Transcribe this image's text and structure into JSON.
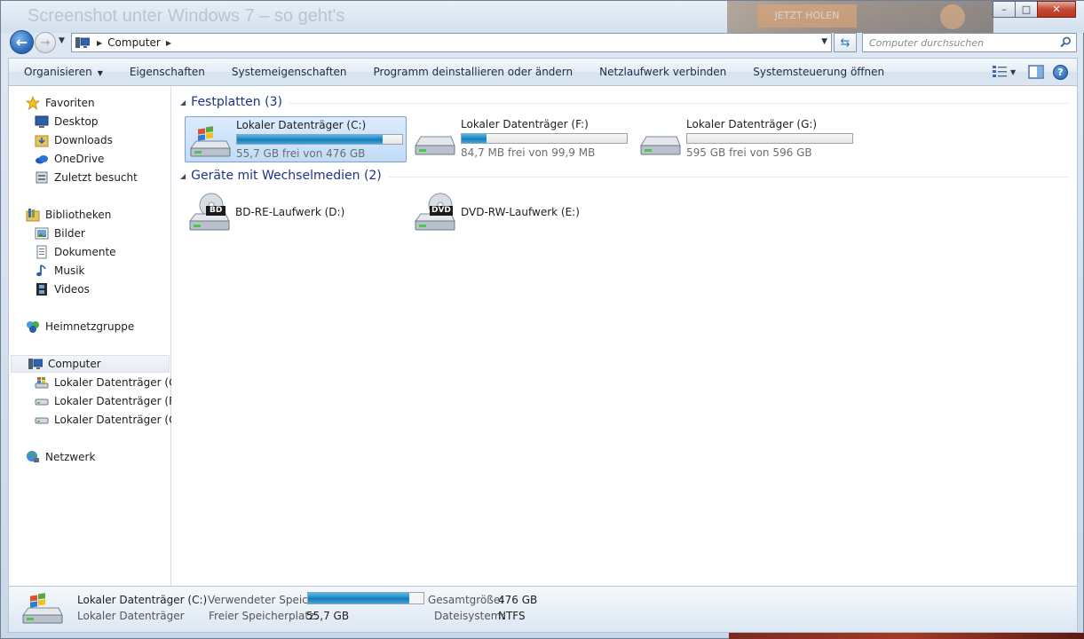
{
  "window": {
    "ghost_title": "Screenshot unter Windows 7 – so geht's",
    "ad_button": "JETZT HOLEN",
    "caption_min": "–",
    "caption_max": "□",
    "caption_close": "✕"
  },
  "address": {
    "crumb": "Computer",
    "search_placeholder": "Computer durchsuchen"
  },
  "toolbar": {
    "organize": "Organisieren",
    "items": [
      "Eigenschaften",
      "Systemeigenschaften",
      "Programm deinstallieren oder ändern",
      "Netzlaufwerk verbinden",
      "Systemsteuerung öffnen"
    ],
    "help": "?"
  },
  "nav": {
    "favorites": "Favoriten",
    "desktop": "Desktop",
    "downloads": "Downloads",
    "onedrive": "OneDrive",
    "recent": "Zuletzt besucht",
    "libraries": "Bibliotheken",
    "pictures": "Bilder",
    "documents": "Dokumente",
    "music": "Musik",
    "videos": "Videos",
    "homegroup": "Heimnetzgruppe",
    "computer": "Computer",
    "drive_c": "Lokaler Datenträger (C:)",
    "drive_f": "Lokaler Datenträger (F:)",
    "drive_g": "Lokaler Datenträger (G:)",
    "network": "Netzwerk"
  },
  "groups": {
    "hard_disks": "Festplatten (3)",
    "removable": "Geräte mit Wechselmedien (2)"
  },
  "drives": [
    {
      "name": "Lokaler Datenträger (C:)",
      "free": "55,7 GB frei von 476 GB",
      "used_fraction": 0.88
    },
    {
      "name": "Lokaler Datenträger (F:)",
      "free": "84,7 MB frei von 99,9 MB",
      "used_fraction": 0.15
    },
    {
      "name": "Lokaler Datenträger (G:)",
      "free": "595 GB frei von 596 GB",
      "used_fraction": 0.002
    }
  ],
  "removable": [
    {
      "name": "BD-RE-Laufwerk (D:)",
      "badge": "BD"
    },
    {
      "name": "DVD-RW-Laufwerk (E:)",
      "badge": "DVD"
    }
  ],
  "details": {
    "name": "Lokaler Datenträger (C:)",
    "type": "Lokaler Datenträger",
    "used_label": "Verwendeter Speic...",
    "used_fraction": 0.88,
    "free_label": "Freier Speicherplatz:",
    "free_value": "55,7 GB",
    "total_label": "Gesamtgröße:",
    "total_value": "476 GB",
    "fs_label": "Dateisystem:",
    "fs_value": "NTFS"
  },
  "colors": {
    "accent": "#2f6fbe",
    "group_title": "#1e3287",
    "progress": "#1f86c8"
  }
}
